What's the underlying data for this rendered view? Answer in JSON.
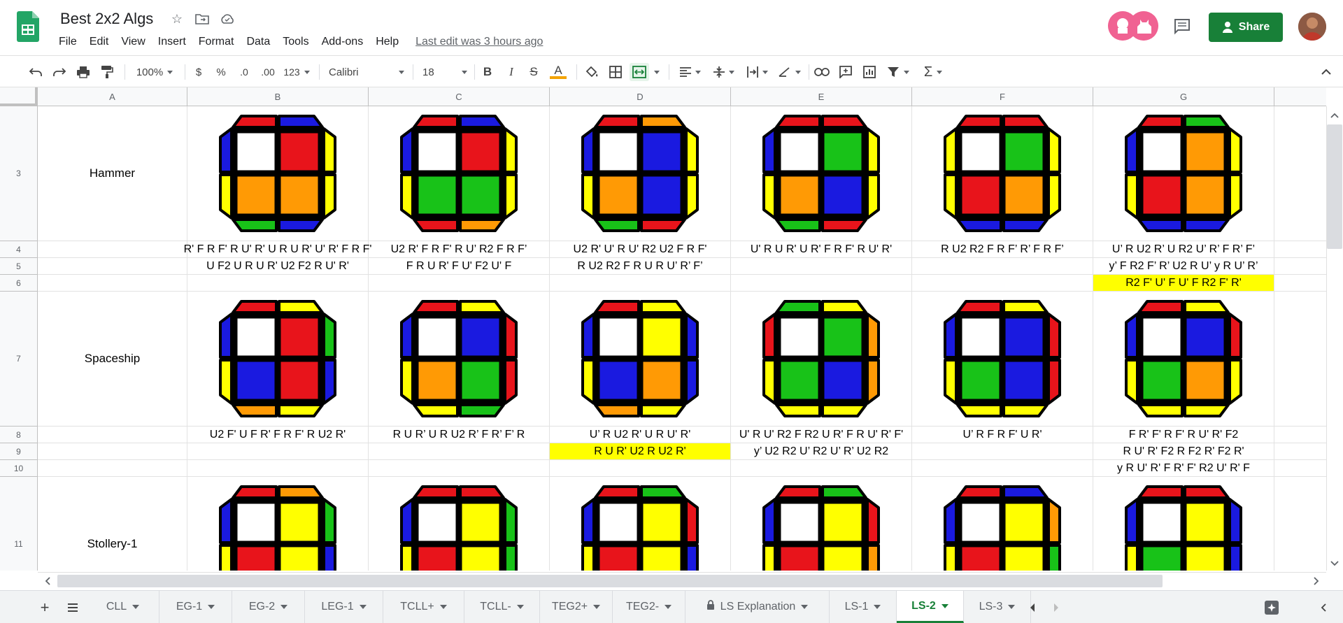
{
  "app": {
    "doc_title": "Best 2x2 Algs",
    "menu": [
      "File",
      "Edit",
      "View",
      "Insert",
      "Format",
      "Data",
      "Tools",
      "Add-ons",
      "Help"
    ],
    "last_edit": "Last edit was 3 hours ago",
    "share_label": "Share"
  },
  "toolbar": {
    "zoom": "100%",
    "currency": "$",
    "percent": "%",
    "dec_decrease": ".0",
    "dec_increase": ".00",
    "number_format": "123",
    "font": "Calibri",
    "font_size": "18",
    "bold": "B",
    "italic": "I",
    "strike": "S",
    "text_color": "A",
    "sum": "Σ"
  },
  "columns": [
    "A",
    "B",
    "C",
    "D",
    "E",
    "F",
    "G"
  ],
  "rows": [
    {
      "num": "3",
      "type": "image",
      "name": "Hammer"
    },
    {
      "num": "4",
      "type": "alg"
    },
    {
      "num": "5",
      "type": "alg"
    },
    {
      "num": "6",
      "type": "alg"
    },
    {
      "num": "7",
      "type": "image",
      "name": "Spaceship"
    },
    {
      "num": "8",
      "type": "alg"
    },
    {
      "num": "9",
      "type": "alg"
    },
    {
      "num": "10",
      "type": "alg"
    },
    {
      "num": "11",
      "type": "image",
      "name": "Stollery-1"
    }
  ],
  "algs": {
    "4": [
      "R' F R F' R U' R' U R U R' U' R' F R F'",
      "U2 R' F R F' R U’ R2 F R F’",
      "U2 R' U' R U' R2 U2 F R F'",
      "U' R U R' U R' F R F' R U' R'",
      "R U2 R2 F R F’ R’ F R F’",
      "U’ R U2 R’ U R2 U’ R’ F R’ F’"
    ],
    "5": [
      "U F2 U R U R' U2 F2 R U' R'",
      "F R U R' F U' F2 U' F",
      "R U2 R2 F R U R U’ R’ F’",
      "",
      "",
      "y’ F R2 F’ R’ U2 R U’ y R U’ R’"
    ],
    "6": [
      "",
      "",
      "",
      "",
      "",
      "R2 F' U' F U' F R2 F' R'"
    ],
    "8": [
      "U2 F' U F R' F R F' R U2 R'",
      "R U R’ U R U2 R’ F R’ F’ R",
      "U’ R U2 R' U R U' R'",
      "U' R U' R2 F R2 U R' F R U' R' F'",
      "U’ R F R F' U R'",
      "F R' F' R F' R U' R' F2"
    ],
    "9": [
      "",
      "",
      "R U R' U2 R U2 R'",
      "y’ U2 R2 U’ R2 U’ R’ U2 R2",
      "",
      "R U' R' F2 R F2 R' F2 R'"
    ],
    "10": [
      "",
      "",
      "",
      "",
      "",
      "y R U' R' F R' F' R2 U' R' F"
    ]
  },
  "highlights": [
    "6:G",
    "9:D"
  ],
  "cubes": {
    "3": [
      {
        "f": [
          "W",
          "R",
          "O",
          "O"
        ],
        "t": [
          "R",
          "B"
        ],
        "b": [
          "G",
          "B"
        ],
        "l": [
          "B",
          "Y"
        ],
        "r": [
          "Y",
          "Y"
        ]
      },
      {
        "f": [
          "W",
          "R",
          "G",
          "G"
        ],
        "t": [
          "R",
          "B"
        ],
        "b": [
          "R",
          "O"
        ],
        "l": [
          "B",
          "Y"
        ],
        "r": [
          "Y",
          "Y"
        ]
      },
      {
        "f": [
          "W",
          "B",
          "O",
          "B"
        ],
        "t": [
          "R",
          "O"
        ],
        "b": [
          "G",
          "R"
        ],
        "l": [
          "B",
          "Y"
        ],
        "r": [
          "Y",
          "Y"
        ]
      },
      {
        "f": [
          "W",
          "G",
          "O",
          "B"
        ],
        "t": [
          "R",
          "R"
        ],
        "b": [
          "G",
          "R"
        ],
        "l": [
          "B",
          "Y"
        ],
        "r": [
          "Y",
          "Y"
        ]
      },
      {
        "f": [
          "W",
          "G",
          "R",
          "O"
        ],
        "t": [
          "R",
          "R"
        ],
        "b": [
          "B",
          "B"
        ],
        "l": [
          "Y",
          "Y"
        ],
        "r": [
          "Y",
          "Y"
        ]
      },
      {
        "f": [
          "W",
          "O",
          "R",
          "O"
        ],
        "t": [
          "R",
          "G"
        ],
        "b": [
          "B",
          "B"
        ],
        "l": [
          "B",
          "Y"
        ],
        "r": [
          "Y",
          "Y"
        ]
      }
    ],
    "7": [
      {
        "f": [
          "W",
          "R",
          "B",
          "R"
        ],
        "t": [
          "R",
          "Y"
        ],
        "b": [
          "O",
          "Y"
        ],
        "l": [
          "B",
          "Y"
        ],
        "r": [
          "G",
          "B"
        ]
      },
      {
        "f": [
          "W",
          "B",
          "O",
          "G"
        ],
        "t": [
          "R",
          "Y"
        ],
        "b": [
          "Y",
          "G"
        ],
        "l": [
          "B",
          "Y"
        ],
        "r": [
          "R",
          "R"
        ]
      },
      {
        "f": [
          "W",
          "Y",
          "B",
          "O"
        ],
        "t": [
          "R",
          "Y"
        ],
        "b": [
          "O",
          "Y"
        ],
        "l": [
          "B",
          "Y"
        ],
        "r": [
          "B",
          "B"
        ]
      },
      {
        "f": [
          "W",
          "G",
          "G",
          "B"
        ],
        "t": [
          "G",
          "Y"
        ],
        "b": [
          "Y",
          "Y"
        ],
        "l": [
          "R",
          "Y"
        ],
        "r": [
          "O",
          "O"
        ]
      },
      {
        "f": [
          "W",
          "B",
          "G",
          "B"
        ],
        "t": [
          "R",
          "Y"
        ],
        "b": [
          "Y",
          "Y"
        ],
        "l": [
          "B",
          "Y"
        ],
        "r": [
          "R",
          "R"
        ]
      },
      {
        "f": [
          "W",
          "B",
          "G",
          "O"
        ],
        "t": [
          "R",
          "Y"
        ],
        "b": [
          "Y",
          "Y"
        ],
        "l": [
          "B",
          "Y"
        ],
        "r": [
          "R",
          "Y"
        ]
      }
    ],
    "11": [
      {
        "f": [
          "W",
          "Y",
          "R",
          "Y"
        ],
        "t": [
          "R",
          "O"
        ],
        "b": [
          "Y",
          "Y"
        ],
        "l": [
          "B",
          "Y"
        ],
        "r": [
          "G",
          "B"
        ]
      },
      {
        "f": [
          "W",
          "Y",
          "R",
          "Y"
        ],
        "t": [
          "R",
          "R"
        ],
        "b": [
          "Y",
          "Y"
        ],
        "l": [
          "B",
          "Y"
        ],
        "r": [
          "G",
          "G"
        ]
      },
      {
        "f": [
          "W",
          "Y",
          "R",
          "Y"
        ],
        "t": [
          "R",
          "G"
        ],
        "b": [
          "Y",
          "Y"
        ],
        "l": [
          "B",
          "Y"
        ],
        "r": [
          "R",
          "B"
        ]
      },
      {
        "f": [
          "W",
          "Y",
          "R",
          "Y"
        ],
        "t": [
          "R",
          "G"
        ],
        "b": [
          "Y",
          "Y"
        ],
        "l": [
          "B",
          "Y"
        ],
        "r": [
          "R",
          "O"
        ]
      },
      {
        "f": [
          "W",
          "Y",
          "R",
          "Y"
        ],
        "t": [
          "R",
          "B"
        ],
        "b": [
          "Y",
          "Y"
        ],
        "l": [
          "B",
          "Y"
        ],
        "r": [
          "O",
          "G"
        ]
      },
      {
        "f": [
          "W",
          "Y",
          "G",
          "Y"
        ],
        "t": [
          "R",
          "R"
        ],
        "b": [
          "Y",
          "Y"
        ],
        "l": [
          "B",
          "Y"
        ],
        "r": [
          "B",
          "B"
        ]
      }
    ]
  },
  "cube_colors": {
    "W": "#ffffff",
    "R": "#e8141b",
    "B": "#1a1ae0",
    "G": "#18c218",
    "O": "#ff9a05",
    "Y": "#ffff00"
  },
  "tabs": [
    {
      "label": "CLL",
      "locked": false
    },
    {
      "label": "EG-1",
      "locked": false
    },
    {
      "label": "EG-2",
      "locked": false
    },
    {
      "label": "LEG-1",
      "locked": false
    },
    {
      "label": "TCLL+",
      "locked": false
    },
    {
      "label": "TCLL-",
      "locked": false
    },
    {
      "label": "TEG2+",
      "locked": false
    },
    {
      "label": "TEG2-",
      "locked": false
    },
    {
      "label": "LS Explanation",
      "locked": true
    },
    {
      "label": "LS-1",
      "locked": false
    },
    {
      "label": "LS-2",
      "locked": false,
      "active": true
    },
    {
      "label": "LS-3",
      "locked": false
    }
  ],
  "theme": {
    "brand_green": "#188038",
    "highlight": "#ffff00"
  }
}
